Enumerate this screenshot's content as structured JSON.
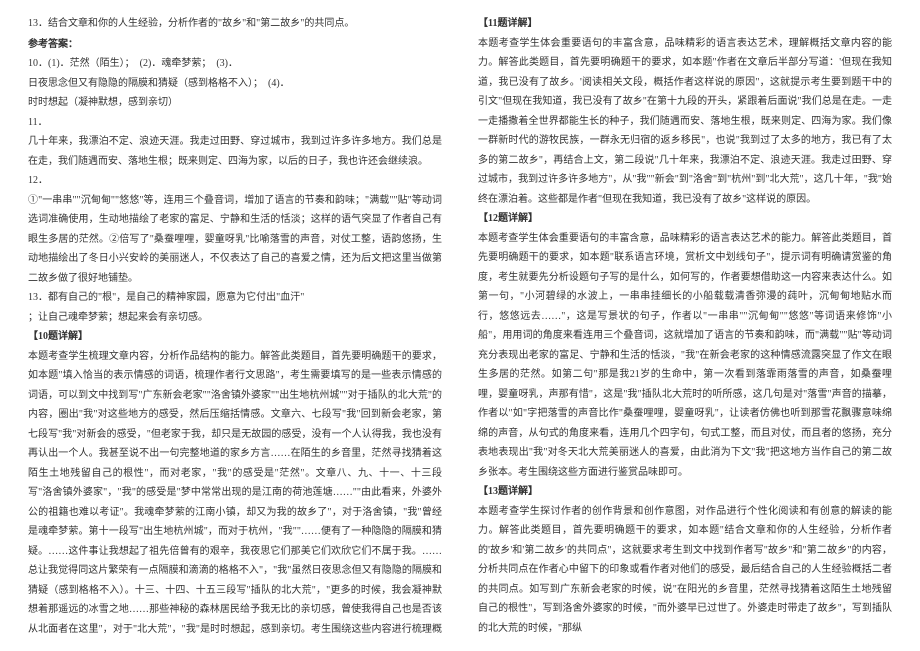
{
  "left": {
    "q13": "13．结合文章和你的人生经验，分析作者的\"故乡\"和\"第二故乡\"的共同点。",
    "answer_label": "参考答案：",
    "a10": "10．(1)．茫然（陌生）；　(2)．魂牵梦萦；　(3)．",
    "a10b": "日夜思念但又有隐隐的隔膜和猜疑（感到格格不入）；　(4)．",
    "a10c": "时时想起（凝神默想，感到亲切）",
    "a11": "11．",
    "a11_body": "几十年来，我漂泊不定、浪迹天涯。我走过田野、穿过城市，我到过许多许多地方。我们总是在走，我们随遇而安、落地生根；既来则定、四海为家，以后的日子，我也许还会继续浪。",
    "a12": "12．",
    "a12_body": "①\"一串串\"\"沉甸甸\"\"悠悠\"等，连用三个叠音词，增加了语言的节奏和韵味；\"满载\"\"贴\"等动词选词准确使用，生动地描绘了老家的富足、宁静和生活的恬淡；这样的语气突显了作者自己有眼生多居的茫然。②倍写了\"桑蚕哩哩，婴童呀乳\"比喻落雪的声音，对仗工整，语韵悠扬，生动地描绘出了冬日小兴安岭的美丽迷人，不仅表达了自己的喜爱之情，还为后文把这里当做第二故乡做了很好地铺垫。",
    "a13": "13．都有自己的\"根\"，是自己的精神家园，愿意为它付出\"血汗\"",
    "a13b": "；让自己魂牵梦萦；想起来会有亲切感。",
    "e10_label": "【10题详解】",
    "e10_body": "本题考查学生梳理文章内容，分析作品结构的能力。解答此类题目，首先要明确题干的要求，如本题\"填入恰当的表示情感的词语，梳理作者行文思路\"，考生需要填写的是一些表示情感的词语，可以到文中找到写\"广东新会老家\"\"洛舍镇外婆家\"\"出生地杭州城\"\"对于插队的北大荒\"的内容，圈出\"我\"对这些地方的感受，然后压缩括情感。文章六、七段写\"我\"回到新会老家，第七段写\"我\"对新会的感受，\"但老家于我，却只是无故园的感受，没有一个人认得我，我也没有再认出一个人。我甚至说不出一句完整地道的家乡方言……在陌生的乡音里，茫然寻找猜着这陌生土地残留自己的根性\"，而对老家，\"我\"的感受是\"茫然\"。文章八、九、十一、十三段写\"洛舍镇外婆家\"，\"我\"的感受是\"梦中常常出现的是江南的荷池莲塘……\"\"由此看来，外婆外公的祖籍也难以考证\"。我魂牵梦萦的江南小镇，却又为我的故乡了\"，对于洛舍镇，\"我\"曾经是魂牵梦萦。第十一段写\"出生地杭州城\"，而对于杭州，\"我\"\"……便有了一种隐隐的隔膜和猜疑。……这件事让我想起了祖先倍曾有的艰辛，我夜思它们那美它们欢欣它们不属于我。……总让我觉得同这片繁荣有一点隔膜和滴滴的格格不入\"，\"我\"虽然日夜思念但又有隐隐的隔膜和猜疑（感到格格不入）。十三、十四、十五三段写\"插队的北大荒\"，\"更多的时候，我会凝神默想着那遥远的冰雪之地……那些神秘的森林居民给予我无比的亲切感，曾使我得自己也是否该从北面者在这里\"，对于\"北大荒\"，\"我\"是时时想起，感到亲切。考生围绕这些内容进行梳理概括即可。"
  },
  "right": {
    "e11_label": "【11题详解】",
    "e11_body": "本题考查学生体会重要语句的丰富含意，品味精彩的语言表达艺术，理解概括文章内容的能力。解答此类题目，首先要明确题干的要求，如本题\"作者在文章后半部分写道：'但现在我知道，我已没有了故乡。'阅读相关文段，概括作者这样说的原因\"，这就提示考生要到题干中的引文\"但现在我知道，我已没有了故乡\"在第十九段的开头，紧跟着后面说\"我们总是在走。一走一走播撒着全世界都能生长的种子，我们随遇而安、落地生根，既来则定、四海为家。我们像一群新时代的游牧民族，一群永无归宿的返乡移民\"，也说\"我到过了太多的地方，我已有了太多的第二故乡\"，再结合上文，第二段说\"几十年来，我漂泊不定、浪迹天涯。我走过田野、穿过城市，我到过许多许多地方\"，从\"我\"\"新会\"到\"洛舍\"到\"杭州\"到\"北大荒\"，这几十年，\"我\"始终在漂泊着。这些都是作者\"但现在我知道，我已没有了故乡\"这样说的原因。",
    "e12_label": "【12题详解】",
    "e12_body": "本题考查学生体会重要语句的丰富含意，品味精彩的语言表达艺术的能力。解答此类题目，首先要明确题干的要求，如本题\"联系语言环境，赏析文中划线句子\"，提示词有明确请赏鉴的角度，考生就要先分析设题句子写的是什么，如何写的，作者要想借助这一内容来表达什么。如第一句，\"小河碧绿的水波上，一串串挂细长的小船载载清香弥漫的莼叶，沉甸甸地贴水而行，悠悠远去……\"，这是写景状的句子，作者以\"一串串\"\"沉甸甸\"\"悠悠\"等词语来修饰\"小船\"，用用词的角度来看连用三个叠音词，这就增加了语言的节奏和韵味，而\"满载\"\"贴\"等动词充分表现出老家的富足、宁静和生活的恬淡，\"我\"在新会老家的这种情感流露突显了作文在眼生多居的茫然。如第二句\"那是我21岁的生命中，第一次看到落霏雨落雪的声音，如桑蚕哩哩，婴童呀乳，声那有惜\"，这是\"我\"插队北大荒时的听所感，这几句是对\"落雪\"声音的描摹，作者以\"如\"字把落雪的声音比作\"桑蚕哩哩，婴童呀乳\"，让读者仿佛也听到那雪花飘骤意味绵绵的声音，从句式的角度来看，连用几个四字句，句式工整，而且对仗，而且者的悠扬，充分表地表现出\"我\"对冬天北大荒美丽迷人的喜爱，由此消为下文\"我\"把这地方当作自己的第二故乡张本。考生围绕这些方面进行鉴赏品味即可。",
    "e13_label": "【13题详解】",
    "e13_body": "本题考查学生探讨作者的创作背景和创作意图，对作品进行个性化阅读和有创意的解读的能力。解答此类题目，首先要明确题干的要求，如本题\"结合文章和你的人生经验，分析作者的'故乡'和'第二故乡'的共同点\"，这就要求考生到文中找到作者写\"故乡\"和\"第二故乡\"的内容，分析共同点在作者心中留下的印象或看作者对他们的感受，最后结合自己的人生经验概括二者的共同点。如写到广东新会老家的时候，说\"在阳光的乡音里，茫然寻找猜着这陌生土地残留自己的根性\"，写到洛舍外婆家的时候，\"而外婆早已过世了。外婆走时带走了故乡\"，写到插队的北大荒的时候，\"那纵"
  }
}
